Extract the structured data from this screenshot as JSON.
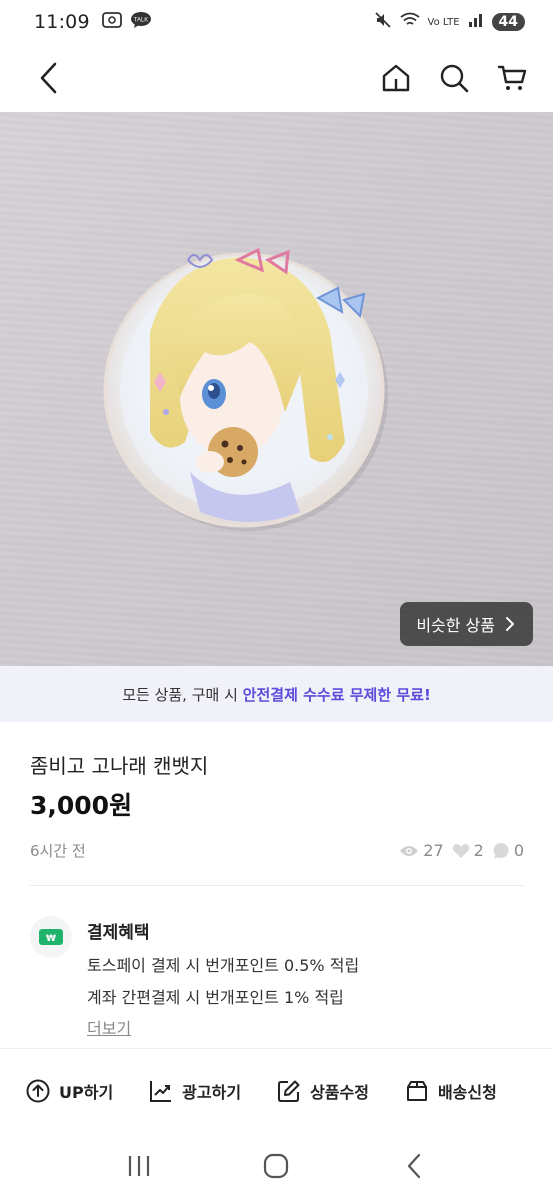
{
  "status_bar": {
    "time": "11:09",
    "battery": "44",
    "network_label": "Vo LTE",
    "talk_badge": "TALK"
  },
  "app_bar": {
    "back_icon": "chevron-left-icon",
    "home_icon": "home-icon",
    "search_icon": "search-icon",
    "cart_icon": "cart-icon"
  },
  "image": {
    "similar_button_label": "비슷한 상품"
  },
  "promo": {
    "prefix": "모든 상품, 구매 시 ",
    "highlight": "안전결제 수수료 무제한 무료!"
  },
  "product": {
    "title": "좀비고 고나래 캔뱃지",
    "price": "3,000원",
    "posted": "6시간 전",
    "views": "27",
    "likes": "2",
    "chats": "0"
  },
  "benefits": {
    "title": "결제혜택",
    "line1": "토스페이 결제 시 번개포인트 0.5% 적립",
    "line2": "계좌 간편결제 시 번개포인트 1% 적립",
    "more": "더보기"
  },
  "actions": [
    {
      "label": "UP하기",
      "icon": "arrow-up-circle-icon"
    },
    {
      "label": "광고하기",
      "icon": "chart-trend-icon"
    },
    {
      "label": "상품수정",
      "icon": "edit-icon"
    },
    {
      "label": "배송신청",
      "icon": "box-icon"
    }
  ],
  "colors": {
    "accent": "#5b4bdb",
    "promo_bg": "#f1f1fa"
  }
}
